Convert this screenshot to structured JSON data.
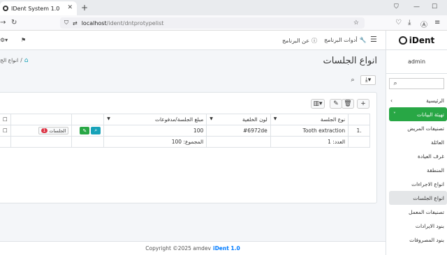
{
  "browser": {
    "tab_title": "IDent System 1.0",
    "url_host": "localhost",
    "url_path": "/ident/dntprotypelist"
  },
  "header": {
    "tools_label": "أدوات البرنامج",
    "about_label": "عن البرنامج"
  },
  "sidebar": {
    "brand": "iDent",
    "user": "admin",
    "items": [
      {
        "label": "الرئيسية"
      },
      {
        "label": "تهيئة البيانات"
      },
      {
        "label": "تصنيفات المريض"
      },
      {
        "label": "العائلة"
      },
      {
        "label": "غرف العيادة"
      },
      {
        "label": "المنطقة"
      },
      {
        "label": "انواع الاجراءات"
      },
      {
        "label": "انواع الجلسات"
      },
      {
        "label": "تصنيفات المعمل"
      },
      {
        "label": "بنود الايرادات"
      },
      {
        "label": "بنود المصروفات"
      }
    ]
  },
  "page": {
    "title": "انواع الجلسات",
    "breadcrumb": "انواع الج"
  },
  "table": {
    "columns": [
      "نوع الجلسة",
      "لون الخلفية",
      "مبلغ الجلسة/مدفوعات"
    ],
    "rows": [
      {
        "index": "1.",
        "type": "Tooth extraction",
        "color": "#6972de",
        "amount": "100",
        "sessions_label": "الجلسات",
        "sessions_count": "1"
      }
    ],
    "count_label": "العدد: 1",
    "sum_label": "المجموع: 100"
  },
  "footer": {
    "copyright": "Copyright ©2025 amdev",
    "brand": "iDent 1.0"
  }
}
